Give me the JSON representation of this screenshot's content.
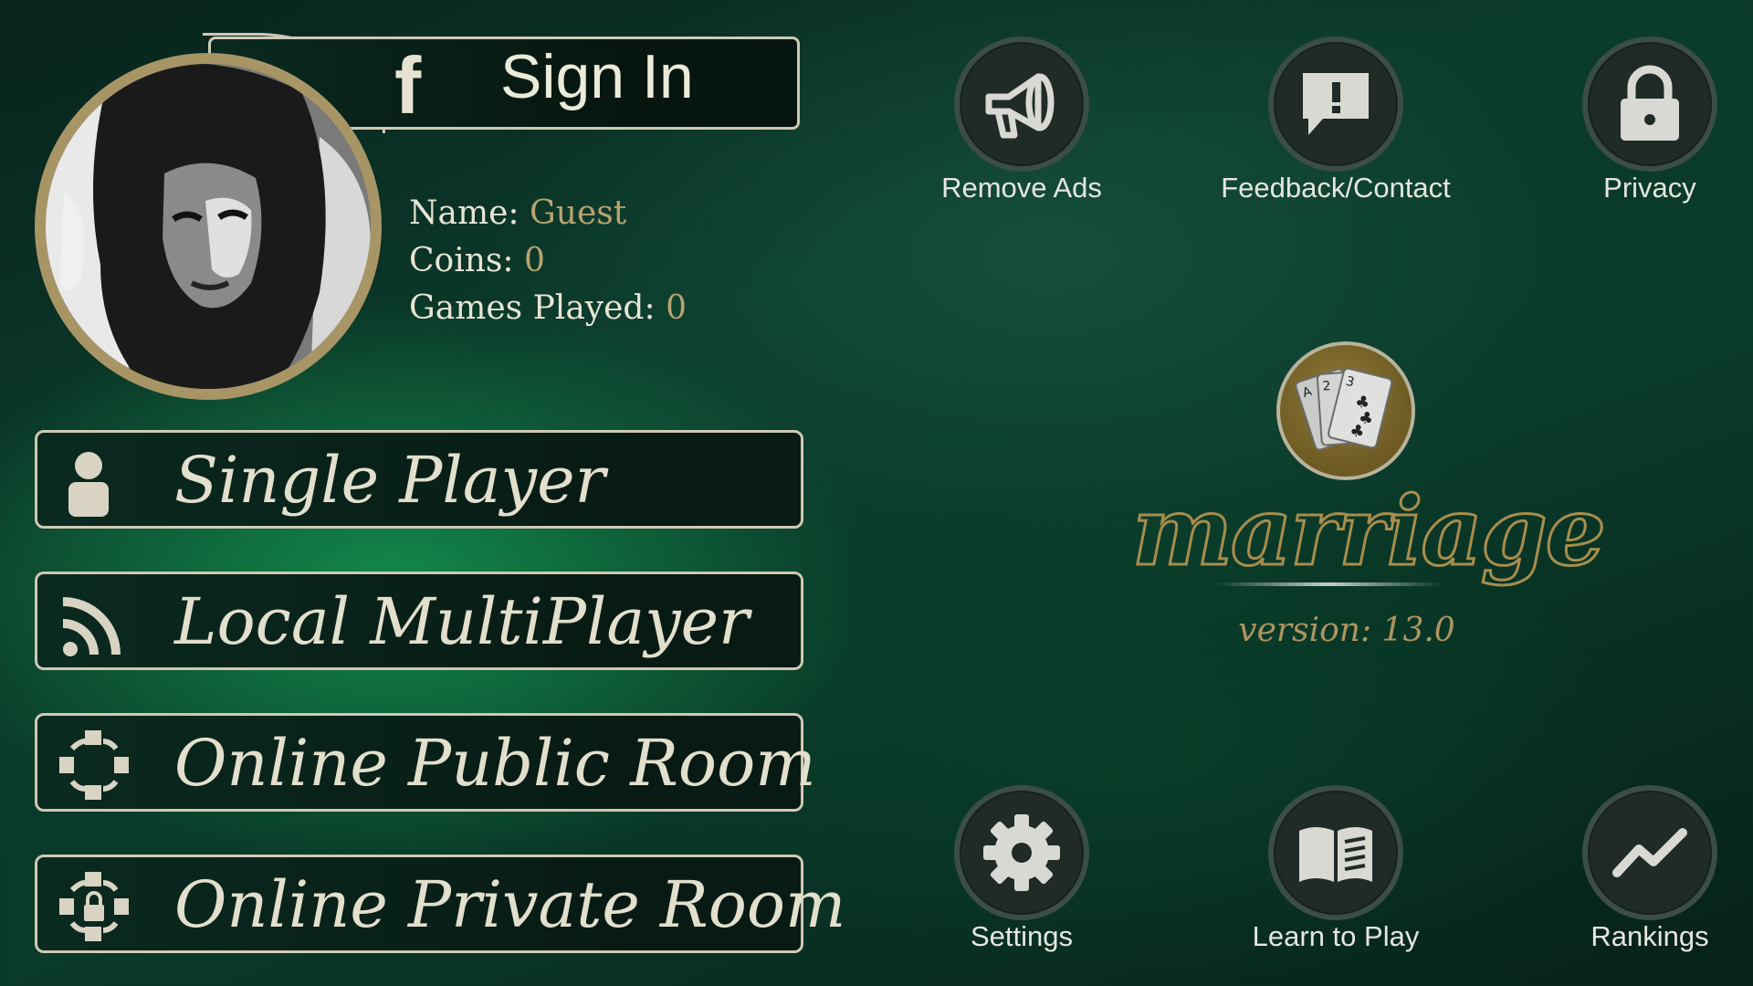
{
  "profile": {
    "sign_in_label": "Sign In",
    "facebook_glyph": "f",
    "name_label": "Name:",
    "name_value": "Guest",
    "coins_label": "Coins:",
    "coins_value": "0",
    "games_label": "Games Played:",
    "games_value": "0"
  },
  "menu": [
    {
      "label": "Single Player",
      "icon": "person-icon"
    },
    {
      "label": "Local MultiPlayer",
      "icon": "wifi-signal-icon"
    },
    {
      "label": "Online Public Room",
      "icon": "connect-arrows-icon"
    },
    {
      "label": "Online Private Room",
      "icon": "lock-arrows-icon"
    }
  ],
  "top_actions": [
    {
      "label": "Remove Ads",
      "icon": "megaphone-icon"
    },
    {
      "label": "Feedback/Contact",
      "icon": "feedback-icon"
    },
    {
      "label": "Privacy",
      "icon": "lock-icon"
    }
  ],
  "bottom_actions": [
    {
      "label": "Settings",
      "icon": "gear-icon"
    },
    {
      "label": "Learn to Play",
      "icon": "book-icon"
    },
    {
      "label": "Rankings",
      "icon": "trend-icon"
    }
  ],
  "logo": {
    "title": "marriage",
    "version": "version: 13.0"
  },
  "colors": {
    "accent_gold": "#b9a36f",
    "border": "#cfc9b4",
    "text": "#e8e4d6"
  }
}
